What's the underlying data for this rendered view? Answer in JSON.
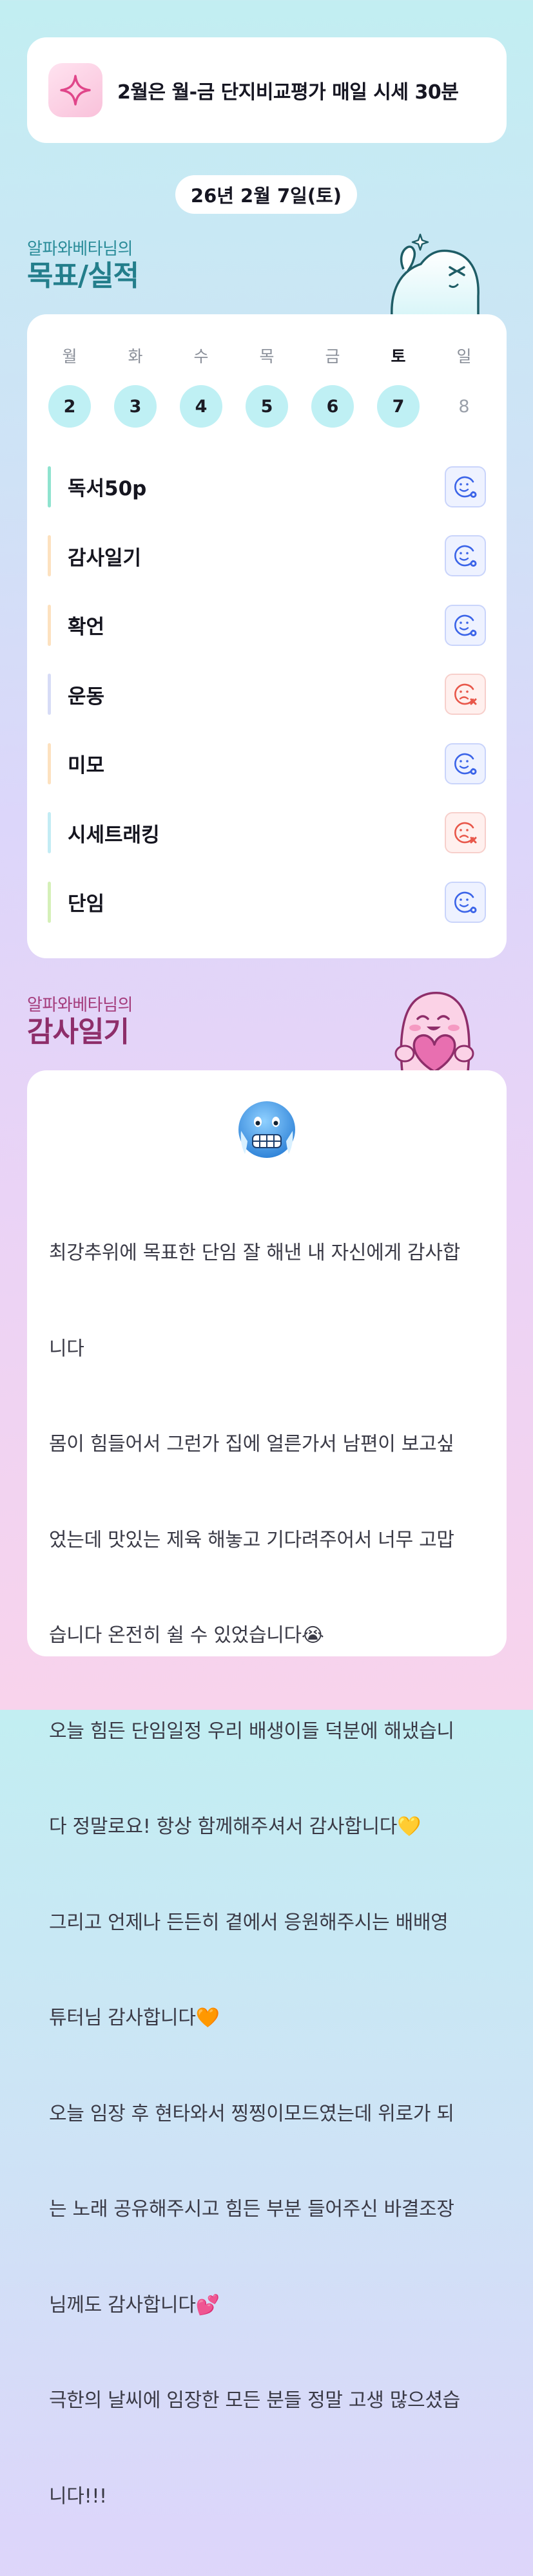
{
  "banner": {
    "icon": "sparkle-icon",
    "text": "2월은 월-금 단지비교평가 매일 시세 30분"
  },
  "date_pill": "26년 2월 7일(토)",
  "goals": {
    "subtitle": "알파와베타님의",
    "title": "목표/실적",
    "week": [
      {
        "day": "월",
        "num": "2",
        "state": "active"
      },
      {
        "day": "화",
        "num": "3",
        "state": "active"
      },
      {
        "day": "수",
        "num": "4",
        "state": "active"
      },
      {
        "day": "목",
        "num": "5",
        "state": "active"
      },
      {
        "day": "금",
        "num": "6",
        "state": "active"
      },
      {
        "day": "토",
        "num": "7",
        "state": "today"
      },
      {
        "day": "일",
        "num": "8",
        "state": "future"
      }
    ],
    "items": [
      {
        "label": "독서50p",
        "bar_color": "#8fe3cf",
        "status": "done",
        "icon": "smile-check-icon"
      },
      {
        "label": "감사일기",
        "bar_color": "#fde1bf",
        "status": "done",
        "icon": "smile-check-icon"
      },
      {
        "label": "확언",
        "bar_color": "#fde1bf",
        "status": "done",
        "icon": "smile-check-icon"
      },
      {
        "label": "운동",
        "bar_color": "#d7dcf6",
        "status": "fail",
        "icon": "sad-x-icon"
      },
      {
        "label": "미모",
        "bar_color": "#fde1bf",
        "status": "done",
        "icon": "smile-check-icon"
      },
      {
        "label": "시세트래킹",
        "bar_color": "#c3ecf4",
        "status": "fail",
        "icon": "sad-x-icon"
      },
      {
        "label": "단임",
        "bar_color": "#d5f0b8",
        "status": "done",
        "icon": "smile-check-icon"
      }
    ]
  },
  "diary": {
    "subtitle": "알파와베타님의",
    "title": "감사일기",
    "mood_icon": "freezing-face-icon",
    "lines": [
      "최강추위에 목표한 단임 잘 해낸 내 자신에게 감사합",
      "니다",
      "몸이 힘들어서 그런가 집에 얼른가서 남편이 보고싶",
      "었는데 맛있는 제육 해놓고 기다려주어서 너무 고맙",
      "습니다 온전히 쉴 수 있었습니다😭",
      "오늘 힘든 단임일정 우리 배생이들 덕분에 해냈습니",
      "다 정말로요! 항상 함께해주셔서 감사합니다💛",
      "그리고 언제나 든든히 곁에서 응원해주시는 배배영",
      "튜터님 감사합니다🧡",
      "오늘 임장 후 현타와서 찡찡이모드였는데 위로가 되",
      "는 노래 공유해주시고 힘든 부분 들어주신 바결조장",
      "님께도 감사합니다💕",
      "극한의 날씨에 임장한 모든 분들 정말 고생 많으셨습",
      "니다!!!"
    ]
  },
  "colors": {
    "goals_title": "#237e8b",
    "diary_title": "#8e2e6a",
    "day_active_bg": "#bff0f4",
    "status_done": "#3b64e8",
    "status_fail": "#e8574a"
  }
}
